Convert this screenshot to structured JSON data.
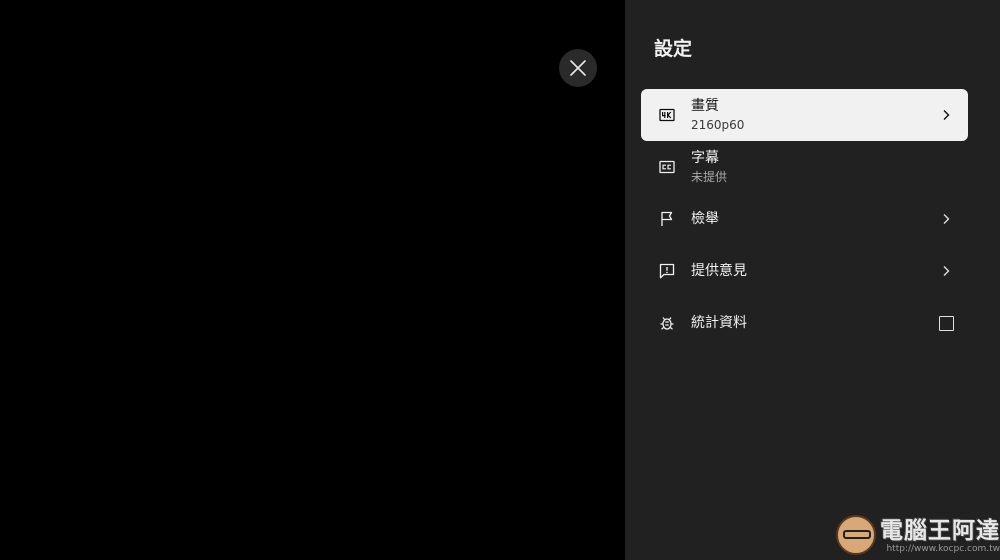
{
  "panel": {
    "title": "設定",
    "items": [
      {
        "icon": "4k-quality-icon",
        "label": "畫質",
        "sublabel": "2160p60",
        "trailing": "chevron",
        "selected": true
      },
      {
        "icon": "closed-captions-icon",
        "label": "字幕",
        "sublabel": "未提供",
        "trailing": "none",
        "selected": false
      },
      {
        "icon": "flag-icon",
        "label": "檢舉",
        "sublabel": "",
        "trailing": "chevron",
        "selected": false
      },
      {
        "icon": "feedback-icon",
        "label": "提供意見",
        "sublabel": "",
        "trailing": "chevron",
        "selected": false
      },
      {
        "icon": "bug-icon",
        "label": "統計資料",
        "sublabel": "",
        "trailing": "checkbox",
        "checked": false,
        "selected": false
      }
    ]
  },
  "close_button": {
    "icon": "close-icon"
  },
  "watermark": {
    "title": "電腦王阿達",
    "url": "http://www.kocpc.com.tw"
  },
  "colors": {
    "background": "#000000",
    "panel": "#212121",
    "selected": "#f1f1f1",
    "text": "#f1f1f1",
    "subtext": "#aaaaaa"
  }
}
